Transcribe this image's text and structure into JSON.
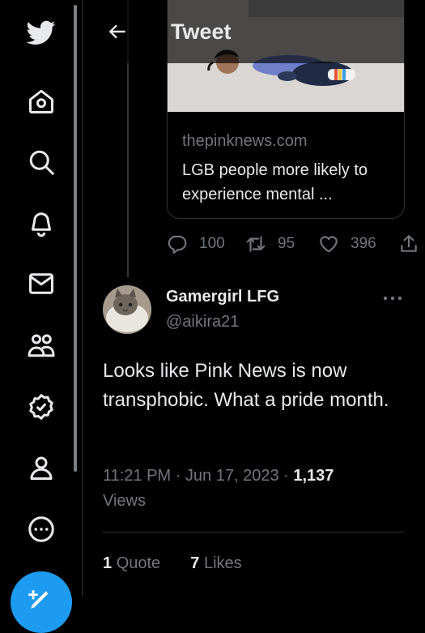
{
  "header": {
    "title": "Tweet"
  },
  "card": {
    "domain": "thepinknews.com",
    "title": "LGB people more likely to experience mental ..."
  },
  "actions": {
    "replies": "100",
    "retweets": "95",
    "likes": "396"
  },
  "tweet": {
    "display_name": "Gamergirl LFG",
    "handle": "@aikira21",
    "text": "Looks like Pink News is now transphobic. What a pride month.",
    "time": "11:21 PM",
    "dot1": " · ",
    "date": "Jun 17, 2023",
    "dot2": " · ",
    "views_count": "1,137",
    "views_label": "Views"
  },
  "stats": {
    "quote_count": "1",
    "quote_label": "Quote",
    "likes_count": "7",
    "likes_label": "Likes"
  },
  "icons": {
    "sidebar": [
      "twitter-logo-icon",
      "home-icon",
      "search-icon",
      "notifications-icon",
      "messages-icon",
      "communities-icon",
      "verified-icon",
      "profile-icon",
      "more-circle-icon"
    ]
  },
  "colors": {
    "accent": "#1d9bf0",
    "text": "#e7e9ea",
    "muted": "#71767b",
    "border": "#2f3336"
  }
}
